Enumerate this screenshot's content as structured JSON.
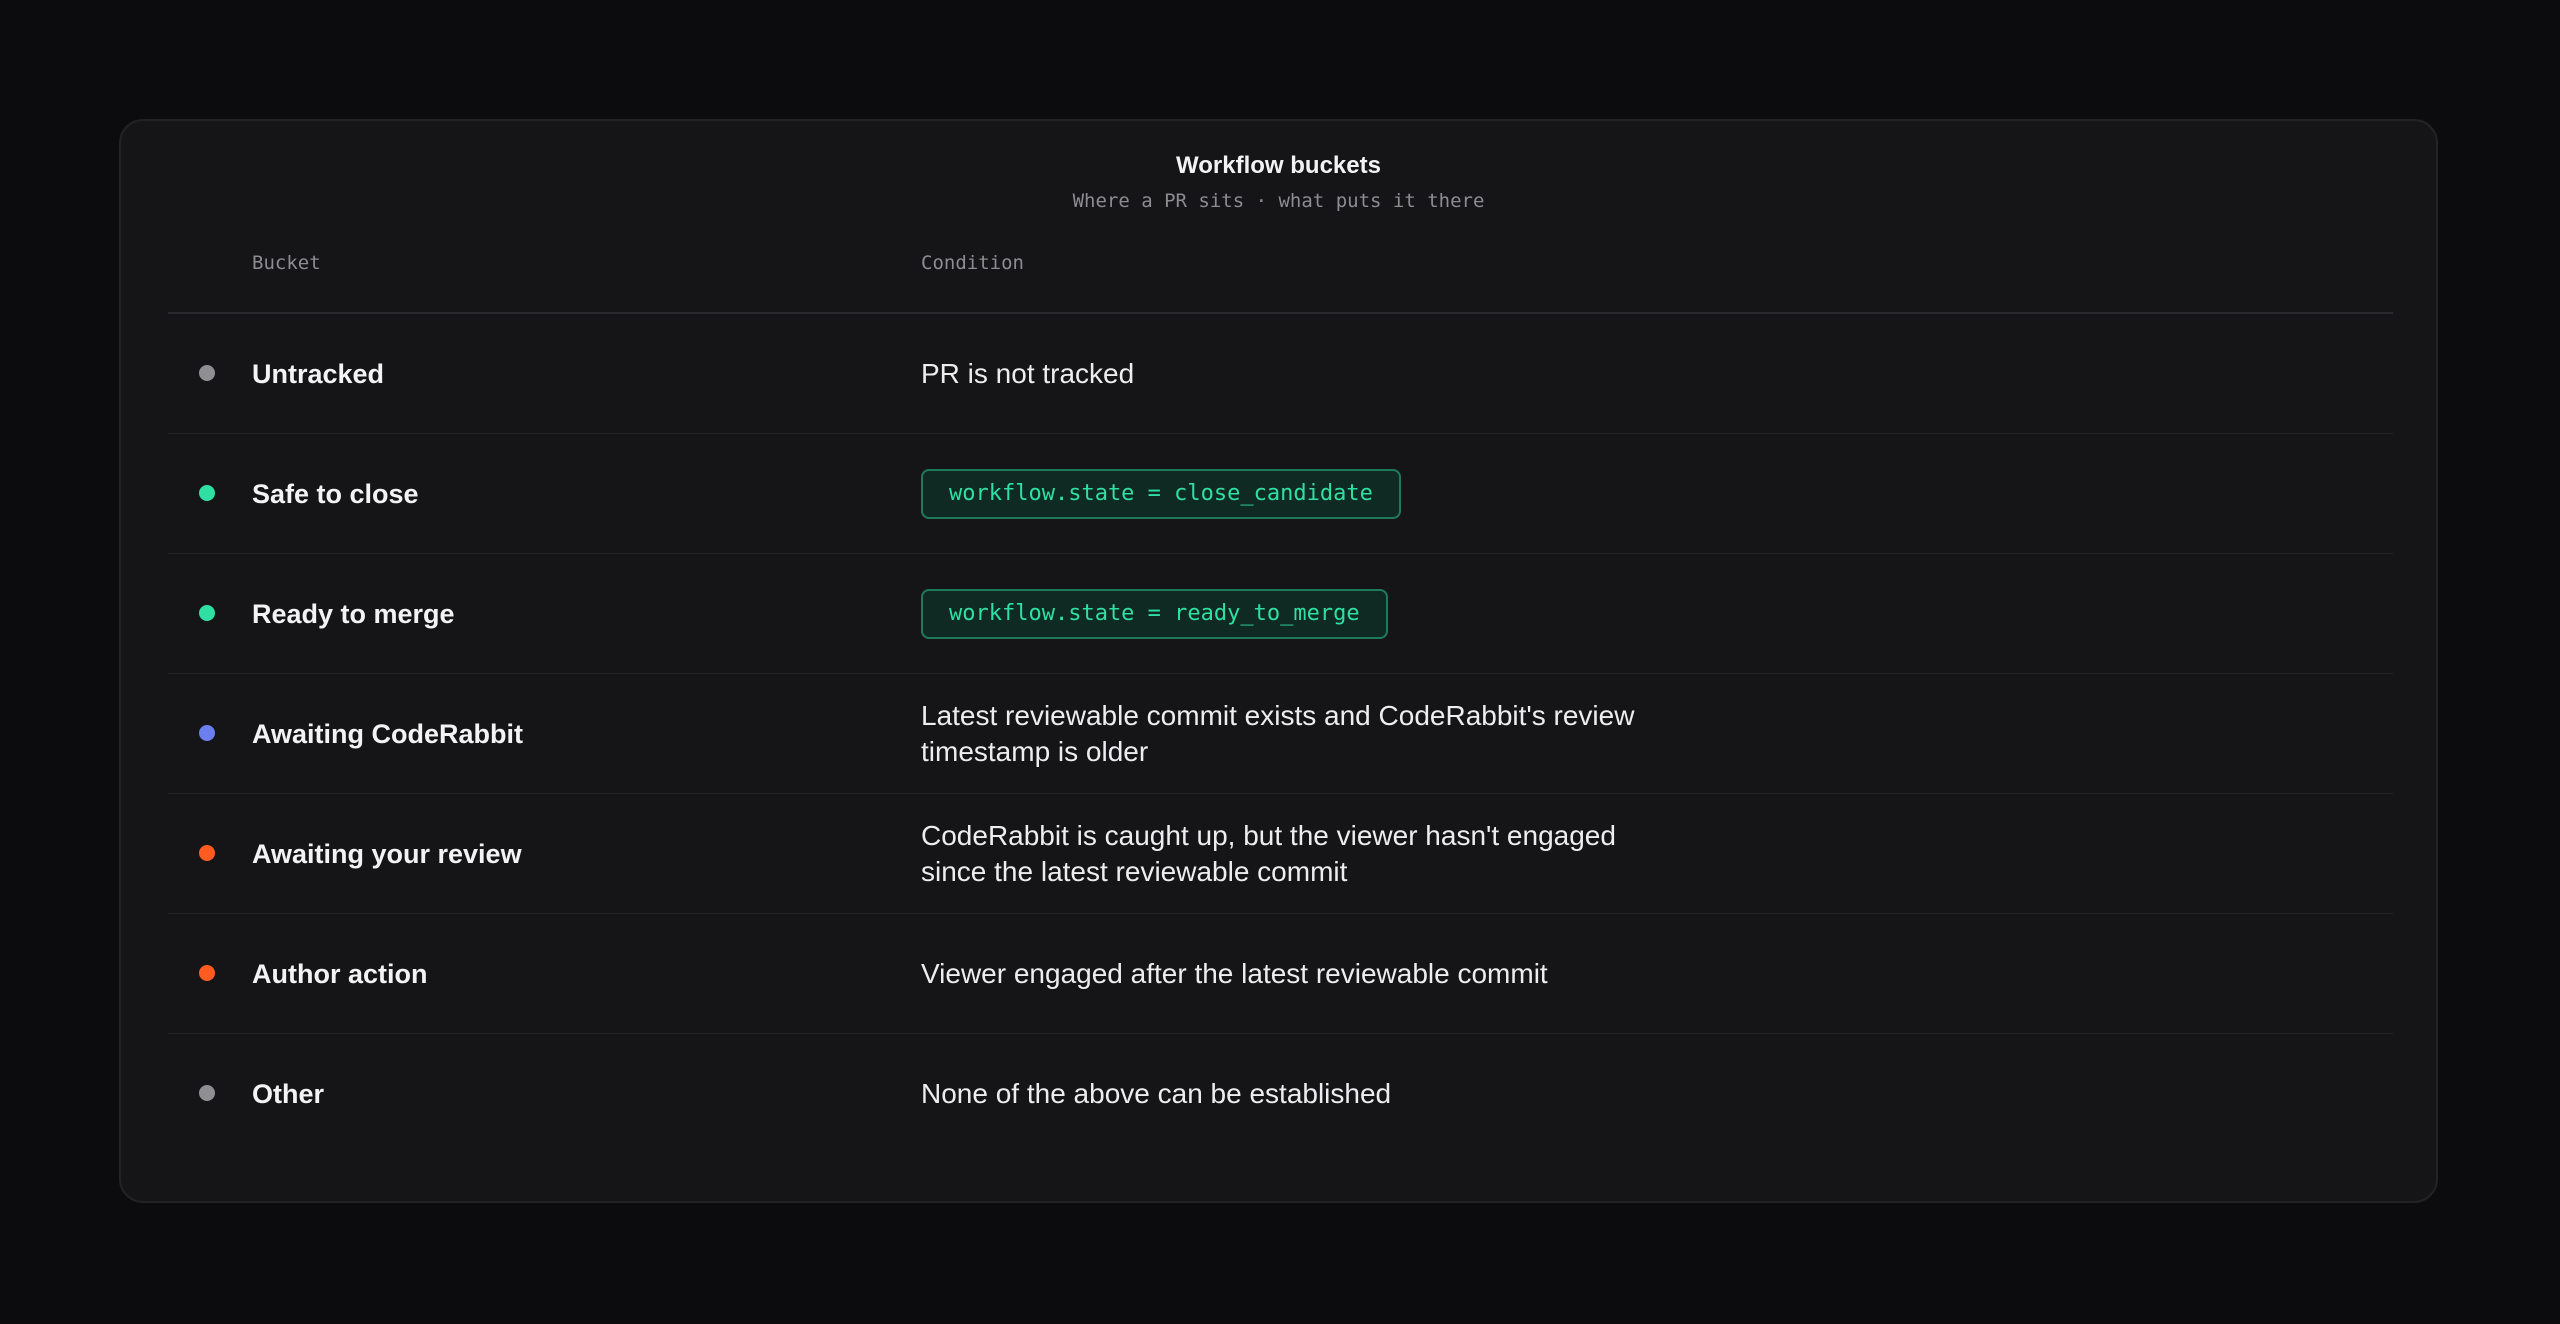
{
  "title": "Workflow buckets",
  "subtitle": "Where a PR sits · what puts it there",
  "columns": {
    "bucket": "Bucket",
    "condition": "Condition"
  },
  "colors": {
    "gray": "#8e8e93",
    "green": "#2fe0a2",
    "blue": "#6b7ff0",
    "orange": "#ff5a1f"
  },
  "rows": [
    {
      "name": "Untracked",
      "dot_color": "#8e8e93",
      "condition": "PR is not tracked",
      "is_code": false
    },
    {
      "name": "Safe to close",
      "dot_color": "#2fe0a2",
      "condition": "workflow.state = close_candidate",
      "is_code": true
    },
    {
      "name": "Ready to merge",
      "dot_color": "#2fe0a2",
      "condition": "workflow.state = ready_to_merge",
      "is_code": true
    },
    {
      "name": "Awaiting CodeRabbit",
      "dot_color": "#6b7ff0",
      "condition": "Latest reviewable commit exists and CodeRabbit's review timestamp is older",
      "is_code": false
    },
    {
      "name": "Awaiting your review",
      "dot_color": "#ff5a1f",
      "condition": "CodeRabbit is caught up, but the viewer hasn't engaged since the latest reviewable commit",
      "is_code": false
    },
    {
      "name": "Author action",
      "dot_color": "#ff5a1f",
      "condition": "Viewer engaged after the latest reviewable commit",
      "is_code": false
    },
    {
      "name": "Other",
      "dot_color": "#8e8e93",
      "condition": "None of the above can be established",
      "is_code": false
    }
  ]
}
